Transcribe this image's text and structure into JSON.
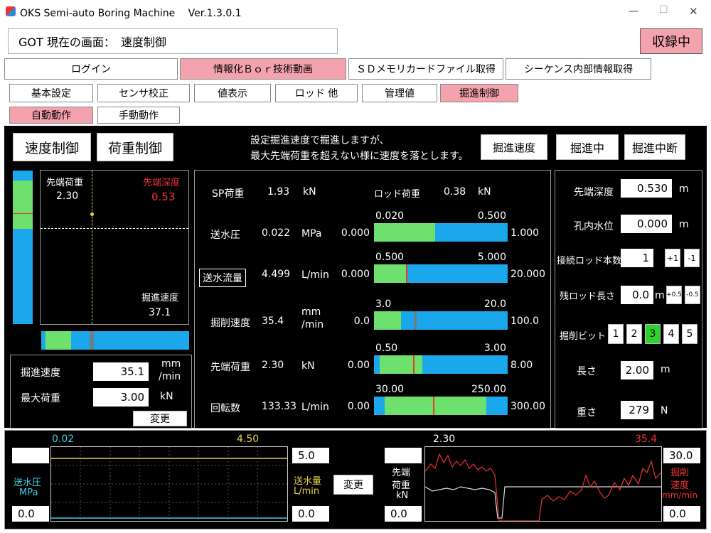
{
  "window": {
    "title": "OKS Semi-auto Boring Machine　 Ver.1.3.0.1",
    "min": "—",
    "max": "☐",
    "close": "✕"
  },
  "header": {
    "got_screen": "GOT 現在の画面：　速度制御",
    "recording": "収録中"
  },
  "tabs1": [
    "ログイン",
    "情報化Ｂｏｒ技術動画",
    "ＳＤメモリカードファイル取得",
    "シーケンス内部情報取得"
  ],
  "tabs2": [
    "基本設定",
    "センサ校正",
    "値表示",
    "ロッド 他",
    "管理値",
    "掘進制御"
  ],
  "tabs3": [
    "自動動作",
    "手動動作"
  ],
  "control": {
    "speed_ctrl": "速度制御",
    "load_ctrl": "荷重制御",
    "desc1": "設定掘進速度で掘進しますが、",
    "desc2": "最大先端荷重を超えない様に速度を落とします。",
    "digging_speed": "掘進速度",
    "digging": "掘進中",
    "interrupt": "掘進中断"
  },
  "plot": {
    "load_label": "先端荷重",
    "load_val": "2.30",
    "depth_label": "先端深度",
    "depth_val": "0.53",
    "speed_label": "掘進速度",
    "speed_val": "37.1"
  },
  "settings": {
    "speed_label": "掘進速度",
    "speed_val": "35.1",
    "speed_unit1": "mm",
    "speed_unit2": "/min",
    "maxload_label": "最大荷重",
    "maxload_val": "3.00",
    "maxload_unit": "kN",
    "change": "変更"
  },
  "mid": {
    "sp_label": "SP荷重",
    "sp_val": "1.93",
    "sp_unit": "kN",
    "rod_label": "ロッド荷重",
    "rod_val": "0.38",
    "rod_unit": "kN",
    "rows": [
      {
        "label": "送水圧",
        "val": "0.022",
        "unit": "MPa",
        "min": "0.000",
        "max": "1.000",
        "lo": "0.020",
        "hi": "0.500"
      },
      {
        "label": "送水流量",
        "val": "4.499",
        "unit": "L/min",
        "min": "0.000",
        "max": "20.000",
        "lo": "0.500",
        "hi": "5.000"
      },
      {
        "label": "掘削速度",
        "val": "35.4",
        "unit": "mm\n/min",
        "min": "0.0",
        "max": "100.0",
        "lo": "3.0",
        "hi": "20.0"
      },
      {
        "label": "先端荷重",
        "val": "2.30",
        "unit": "kN",
        "min": "0.00",
        "max": "8.00",
        "lo": "0.50",
        "hi": "3.00"
      },
      {
        "label": "回転数",
        "val": "133.33",
        "unit": "L/min",
        "min": "0.00",
        "max": "300.00",
        "lo": "30.00",
        "hi": "250.00"
      }
    ]
  },
  "right": {
    "depth_label": "先端深度",
    "depth_val": "0.530",
    "depth_unit": "m",
    "water_label": "孔内水位",
    "water_val": "0.000",
    "water_unit": "m",
    "rods_label": "接続ロッド本数",
    "rods_val": "1",
    "plus1": "+1",
    "minus1": "-1",
    "remain_label": "残ロッド長さ",
    "remain_val": "0.0",
    "remain_unit": "m",
    "plus05": "+0.5",
    "minus05": "-0.5",
    "bit_label": "掘削ビット",
    "bits": [
      "1",
      "2",
      "3",
      "4",
      "5"
    ],
    "len_label": "長さ",
    "len_val": "2.00",
    "len_unit": "m",
    "wt_label": "重さ",
    "wt_val": "279",
    "wt_unit": "N"
  },
  "bottom": {
    "left": {
      "top_a": "0.02",
      "top_b": "4.50",
      "empty": "",
      "press_label": "送水圧",
      "press_unit": "MPa",
      "press_val": "0.0",
      "flow_max": "5.0",
      "flow_label": "送水量",
      "flow_unit": "L/min",
      "flow_val": "0.0",
      "change": "変更"
    },
    "right": {
      "top_a": "2.30",
      "top_b": "35.4",
      "tip1": "先端",
      "tip2": "荷重",
      "tip3": "kN",
      "tip_val": "0.0",
      "max": "30.0",
      "dig1": "掘削",
      "dig2": "速度",
      "dig3": "mm/min",
      "dig_val": "0.0"
    }
  },
  "chart_data": {
    "type": "line",
    "series": [
      {
        "values": []
      },
      {
        "values": []
      }
    ]
  }
}
